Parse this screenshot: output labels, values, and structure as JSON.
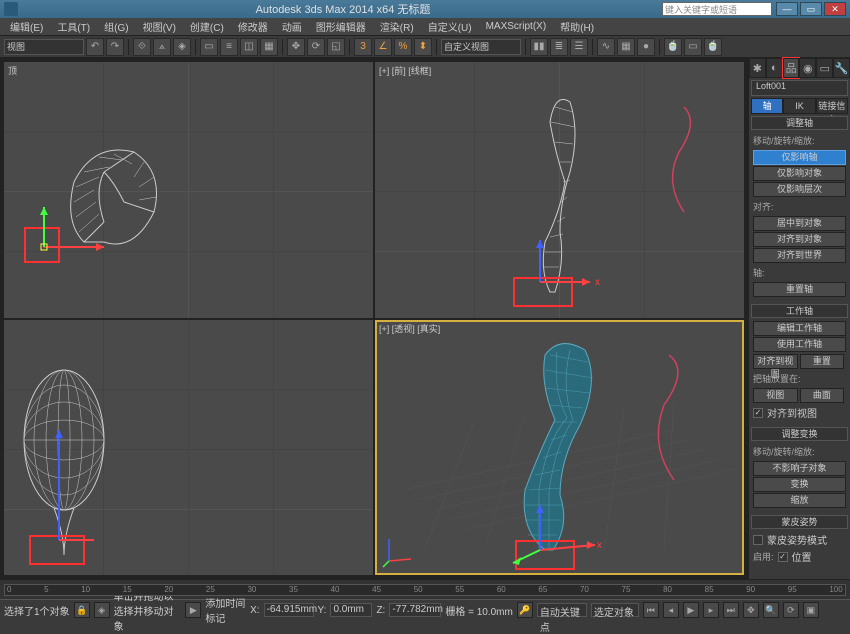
{
  "title": "Autodesk 3ds Max  2014 x64    无标题",
  "searchPlaceholder": "键入关键字或短语",
  "menu": [
    "编辑(E)",
    "工具(T)",
    "组(G)",
    "视图(V)",
    "创建(C)",
    "修改器",
    "动画",
    "图形编辑器",
    "渲染(R)",
    "自定义(U)",
    "MAXScript(X)",
    "帮助(H)"
  ],
  "toolbar": {
    "viewDropdown": "视图",
    "snapDropdown": "自定义视图"
  },
  "viewports": {
    "topLeft": {
      "label": "顶"
    },
    "topRight": {
      "label": "[+] [前] [线框]"
    },
    "bottomLeft": {
      "label": ""
    },
    "bottomRight": {
      "label": "[+] [透视] [真实]"
    }
  },
  "cmdpanel": {
    "objectName": "Loft001",
    "subtabs": [
      "轴",
      "IK",
      "链接信息"
    ],
    "rollouts": {
      "adjustPivot": {
        "title": "调整轴",
        "label": "移动/旋转/缩放:",
        "btns": [
          "仅影响轴",
          "仅影响对象",
          "仅影响层次"
        ]
      },
      "align": {
        "title": "对齐:",
        "btns": [
          "居中到对象",
          "对齐到对象",
          "对齐到世界"
        ]
      },
      "axis": {
        "title": "轴:",
        "btn": "重置轴"
      },
      "workPivot": {
        "title": "工作轴",
        "btns": [
          "编辑工作轴",
          "使用工作轴"
        ],
        "halfBtns": [
          "对齐到视图",
          "重置"
        ],
        "placeLabel": "把轴放置在:",
        "placeBtns": [
          "视图",
          "曲面"
        ],
        "check": "对齐到视图"
      },
      "adjustXform": {
        "title": "调整变换",
        "label": "移动/旋转/缩放:",
        "btn": "不影响子对象",
        "btns2": [
          "变换",
          "缩放"
        ]
      },
      "skinPose": {
        "title": "蒙皮姿势",
        "check": "蒙皮姿势模式",
        "enableLabel": "启用:",
        "enableCheck": "位置"
      }
    }
  },
  "status": {
    "selection": "选择了1个对象",
    "hint": "单击并拖动以选择并移动对象",
    "addTime": "添加时间标记",
    "x": "-64.915mm",
    "y": "0.0mm",
    "z": "-77.782mm",
    "grid": "栅格 = 10.0mm",
    "autokey": "自动关键点",
    "filter": "选定对象"
  },
  "time": {
    "ticks": [
      "0",
      "5",
      "10",
      "15",
      "20",
      "25",
      "30",
      "35",
      "40",
      "45",
      "50",
      "55",
      "60",
      "65",
      "70",
      "75",
      "80",
      "85",
      "90",
      "95",
      "100"
    ]
  }
}
